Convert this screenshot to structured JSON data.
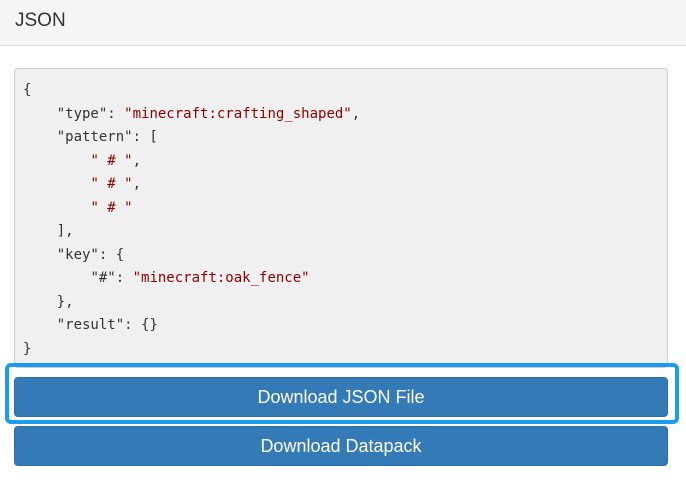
{
  "header": {
    "title": "JSON"
  },
  "code": {
    "lines": [
      [
        {
          "t": "p",
          "v": "{"
        }
      ],
      [
        {
          "t": "p",
          "v": "    "
        },
        {
          "t": "k",
          "v": "\"type\""
        },
        {
          "t": "p",
          "v": ": "
        },
        {
          "t": "s",
          "v": "\"minecraft:crafting_shaped\""
        },
        {
          "t": "p",
          "v": ","
        }
      ],
      [
        {
          "t": "p",
          "v": "    "
        },
        {
          "t": "k",
          "v": "\"pattern\""
        },
        {
          "t": "p",
          "v": ": ["
        }
      ],
      [
        {
          "t": "p",
          "v": "        "
        },
        {
          "t": "s",
          "v": "\" # \""
        },
        {
          "t": "p",
          "v": ","
        }
      ],
      [
        {
          "t": "p",
          "v": "        "
        },
        {
          "t": "s",
          "v": "\" # \""
        },
        {
          "t": "p",
          "v": ","
        }
      ],
      [
        {
          "t": "p",
          "v": "        "
        },
        {
          "t": "s",
          "v": "\" # \""
        }
      ],
      [
        {
          "t": "p",
          "v": "    ],"
        }
      ],
      [
        {
          "t": "p",
          "v": "    "
        },
        {
          "t": "k",
          "v": "\"key\""
        },
        {
          "t": "p",
          "v": ": {"
        }
      ],
      [
        {
          "t": "p",
          "v": "        "
        },
        {
          "t": "k",
          "v": "\"#\""
        },
        {
          "t": "p",
          "v": ": "
        },
        {
          "t": "s",
          "v": "\"minecraft:oak_fence\""
        }
      ],
      [
        {
          "t": "p",
          "v": "    },"
        }
      ],
      [
        {
          "t": "p",
          "v": "    "
        },
        {
          "t": "k",
          "v": "\"result\""
        },
        {
          "t": "p",
          "v": ": {}"
        }
      ],
      [
        {
          "t": "p",
          "v": "}"
        }
      ]
    ]
  },
  "buttons": {
    "download_json": "Download JSON File",
    "download_datapack": "Download Datapack"
  },
  "colors": {
    "button_bg": "#337ab7",
    "highlight": "#1a9cf0",
    "string": "#8b0000",
    "code_bg": "#f0f0f0"
  }
}
